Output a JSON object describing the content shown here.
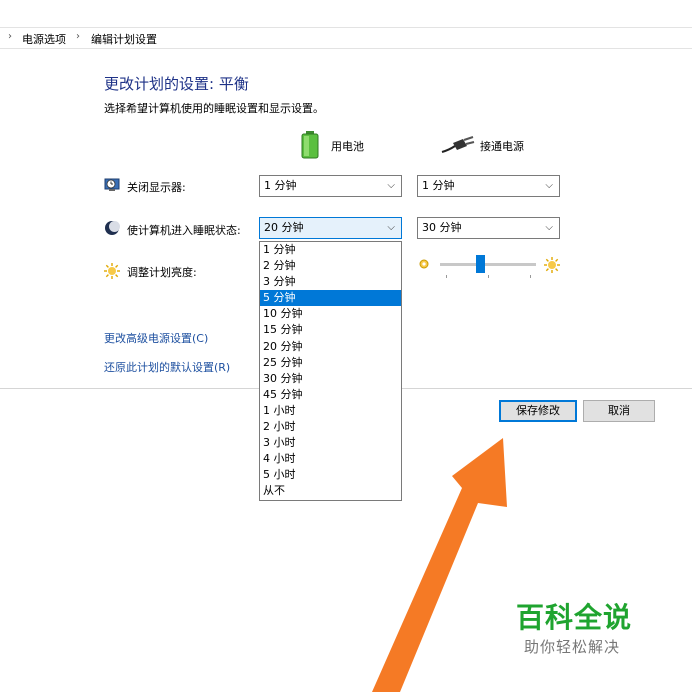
{
  "breadcrumb": {
    "items": [
      "电源选项",
      "编辑计划设置"
    ]
  },
  "page": {
    "title": "更改计划的设置: 平衡",
    "subtitle": "选择希望计算机使用的睡眠设置和显示设置。"
  },
  "columns": {
    "battery": "用电池",
    "plugged": "接通电源"
  },
  "rows": {
    "display": {
      "label": "关闭显示器:",
      "battery_value": "1 分钟",
      "plugged_value": "1 分钟"
    },
    "sleep": {
      "label": "使计算机进入睡眠状态:",
      "battery_value": "20 分钟",
      "plugged_value": "30 分钟"
    },
    "brightness": {
      "label": "调整计划亮度:",
      "plugged_level_percent": 60
    }
  },
  "dropdown": {
    "options": [
      "1 分钟",
      "2 分钟",
      "3 分钟",
      "5 分钟",
      "10 分钟",
      "15 分钟",
      "20 分钟",
      "25 分钟",
      "30 分钟",
      "45 分钟",
      "1 小时",
      "2 小时",
      "3 小时",
      "4 小时",
      "5 小时",
      "从不"
    ],
    "highlighted_index": 3
  },
  "links": {
    "advanced": "更改高级电源设置(C)",
    "restore": "还原此计划的默认设置(R)"
  },
  "buttons": {
    "save": "保存修改",
    "cancel": "取消"
  },
  "watermark": {
    "title": "百科全说",
    "subtitle": "助你轻松解决"
  },
  "colors": {
    "accent": "#0078d7",
    "arrow": "#f57a25",
    "watermark_green": "#1fa42f"
  }
}
